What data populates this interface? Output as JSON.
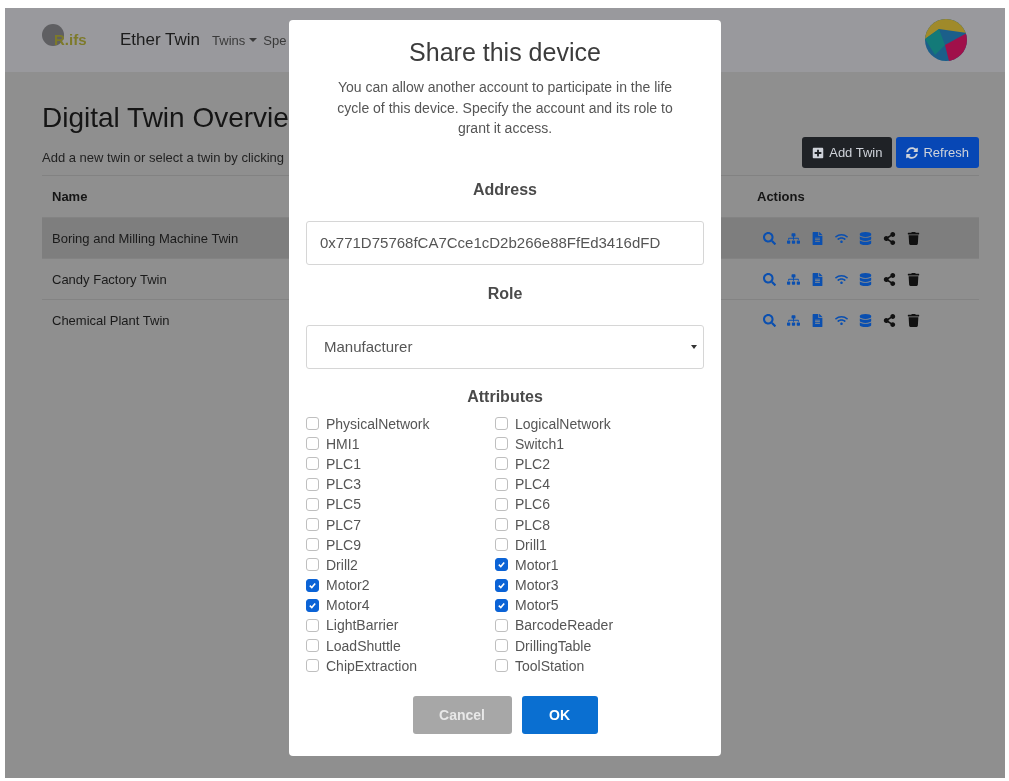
{
  "navbar": {
    "logo": "R.ifs",
    "brand": "Ether Twin",
    "menu": [
      {
        "label": "Twins",
        "dropdown": true
      },
      {
        "label": "Spe",
        "dropdown": false
      }
    ]
  },
  "page": {
    "title": "Digital Twin Overvie",
    "subtitle": "Add a new twin or select a twin by clicking",
    "buttons": [
      {
        "label": "Add Twin",
        "kind": "dark"
      },
      {
        "label": "Refresh",
        "kind": "primary"
      }
    ],
    "table": {
      "columns": [
        "Name",
        "Actions"
      ],
      "rows": [
        {
          "name": "Boring and Milling Machine Twin",
          "selected": true
        },
        {
          "name": "Candy Factory Twin",
          "selected": false
        },
        {
          "name": "Chemical Plant Twin",
          "selected": false
        }
      ]
    }
  },
  "dialog": {
    "title": "Share this device",
    "description": "You can allow another account to participate in the life cycle of this device. Specify the account and its role to grant it access.",
    "address_label": "Address",
    "address_value": "0x771D75768fCA7Cce1cD2b266e88FfEd3416dFD",
    "role_label": "Role",
    "role_value": "Manufacturer",
    "attributes_label": "Attributes",
    "attributes": [
      {
        "label": "PhysicalNetwork",
        "checked": false
      },
      {
        "label": "LogicalNetwork",
        "checked": false
      },
      {
        "label": "HMI1",
        "checked": false
      },
      {
        "label": "Switch1",
        "checked": false
      },
      {
        "label": "PLC1",
        "checked": false
      },
      {
        "label": "PLC2",
        "checked": false
      },
      {
        "label": "PLC3",
        "checked": false
      },
      {
        "label": "PLC4",
        "checked": false
      },
      {
        "label": "PLC5",
        "checked": false
      },
      {
        "label": "PLC6",
        "checked": false
      },
      {
        "label": "PLC7",
        "checked": false
      },
      {
        "label": "PLC8",
        "checked": false
      },
      {
        "label": "PLC9",
        "checked": false
      },
      {
        "label": "Drill1",
        "checked": false
      },
      {
        "label": "Drill2",
        "checked": false
      },
      {
        "label": "Motor1",
        "checked": true
      },
      {
        "label": "Motor2",
        "checked": true
      },
      {
        "label": "Motor3",
        "checked": true
      },
      {
        "label": "Motor4",
        "checked": true
      },
      {
        "label": "Motor5",
        "checked": true
      },
      {
        "label": "LightBarrier",
        "checked": false
      },
      {
        "label": "BarcodeReader",
        "checked": false
      },
      {
        "label": "LoadShuttle",
        "checked": false
      },
      {
        "label": "DrillingTable",
        "checked": false
      },
      {
        "label": "ChipExtraction",
        "checked": false
      },
      {
        "label": "ToolStation",
        "checked": false
      }
    ],
    "buttons": [
      {
        "label": "Cancel",
        "kind": "secondary"
      },
      {
        "label": "OK",
        "kind": "primary"
      }
    ]
  }
}
